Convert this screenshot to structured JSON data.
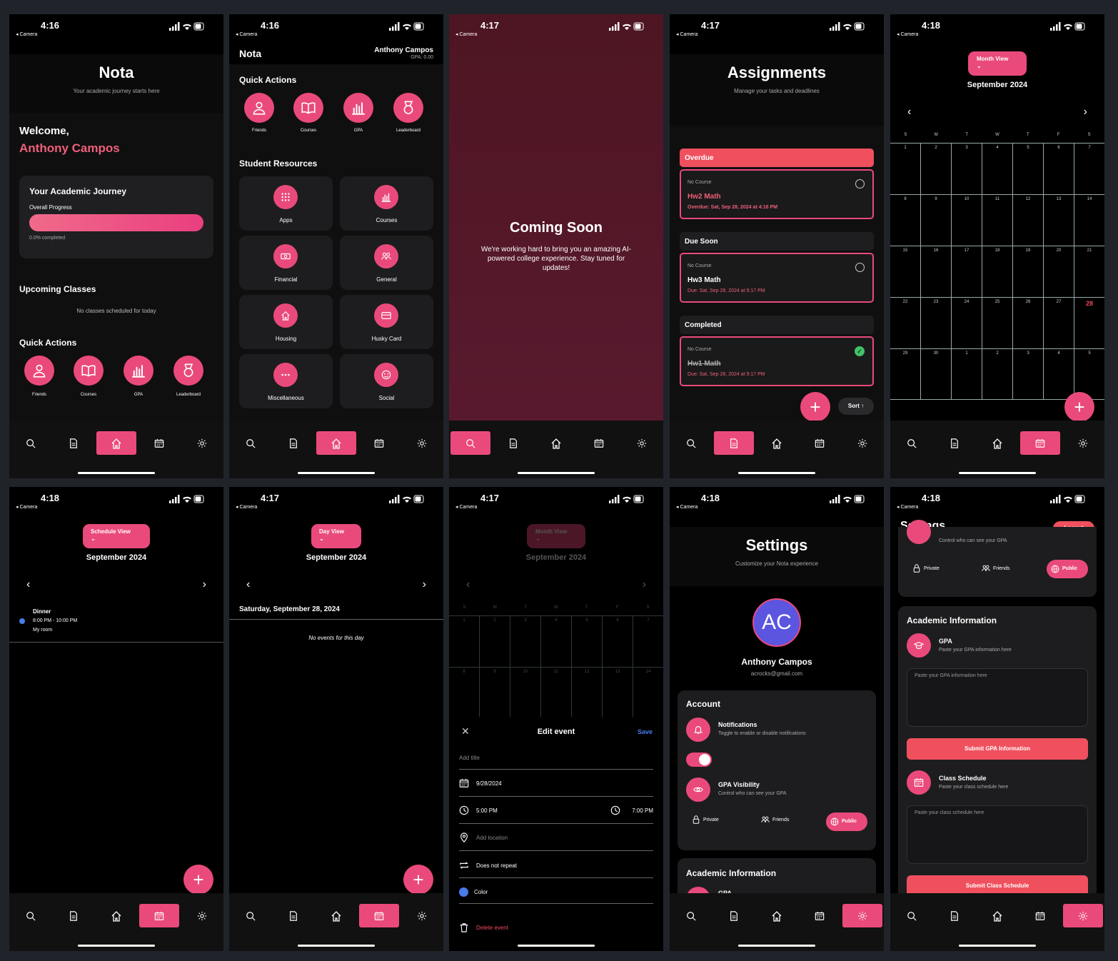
{
  "status": {
    "t1": "4:16",
    "t2": "4:16",
    "t3": "4:17",
    "t4": "4:17",
    "t5": "4:18",
    "t6": "4:18",
    "t7": "4:17",
    "t8": "4:17",
    "t9": "4:18",
    "t10": "4:18",
    "back": "◂ Camera"
  },
  "home": {
    "title": "Nota",
    "subtitle": "Your academic journey starts here",
    "welcome": "Welcome,",
    "name": "Anthony Campos",
    "journey_title": "Your Academic Journey",
    "progress_label": "Overall Progress",
    "progress_text": "0.0% completed",
    "progress_value": 0,
    "upcoming_title": "Upcoming Classes",
    "no_classes": "No classes scheduled for today",
    "qa_title": "Quick Actions",
    "qa": [
      "Friends",
      "Courses",
      "GPA",
      "Leaderboard"
    ]
  },
  "resources": {
    "app": "Nota",
    "user": "Anthony Campos",
    "gpa": "GPA: 0.00",
    "qa_title": "Quick Actions",
    "qa": [
      "Friends",
      "Courses",
      "GPA",
      "Leaderboard"
    ],
    "res_title": "Student Resources",
    "items": [
      "Apps",
      "Courses",
      "Financial",
      "General",
      "Housing",
      "Husky Card",
      "Miscellaneous",
      "Social"
    ]
  },
  "coming": {
    "title": "Coming Soon",
    "body": "We're working hard to bring you an amazing AI-powered college experience. Stay tuned for updates!"
  },
  "assign": {
    "title": "Assignments",
    "subtitle": "Manage your tasks and deadlines",
    "overdue": "Overdue",
    "due_soon": "Due Soon",
    "completed": "Completed",
    "a1": {
      "course": "No Course",
      "name": "Hw2 Math",
      "due": "Overdue: Sat, Sep 28, 2024 at 4:16 PM"
    },
    "a2": {
      "course": "No Course",
      "name": "Hw3 Math",
      "due": "Due: Sat, Sep 28, 2024 at 9:17 PM"
    },
    "a3": {
      "course": "No Course",
      "name": "Hw1 Math",
      "due": "Due: Sat, Sep 28, 2024 at 9:17 PM"
    },
    "sort": "Sort ↑"
  },
  "month": {
    "view": "Month View",
    "month": "September 2024",
    "days": [
      "S",
      "M",
      "T",
      "W",
      "T",
      "F",
      "S"
    ],
    "weeks": [
      [
        "1",
        "2",
        "3",
        "4",
        "5",
        "6",
        "7"
      ],
      [
        "8",
        "9",
        "10",
        "11",
        "12",
        "13",
        "14"
      ],
      [
        "15",
        "16",
        "17",
        "18",
        "19",
        "20",
        "21"
      ],
      [
        "22",
        "23",
        "24",
        "25",
        "26",
        "27",
        "28"
      ],
      [
        "29",
        "30",
        "1",
        "2",
        "3",
        "4",
        "5"
      ]
    ]
  },
  "schedule": {
    "view": "Schedule View",
    "month": "September 2024",
    "event": "Dinner",
    "time": "8:00 PM - 10:00 PM",
    "loc": "My room"
  },
  "day": {
    "view": "Day View",
    "month": "September 2024",
    "date": "Saturday, September 28, 2024",
    "empty": "No events for this day"
  },
  "edit": {
    "view": "Month View",
    "month": "September 2024",
    "title": "Edit event",
    "save": "Save",
    "add_title": "Add title",
    "date": "9/28/2024",
    "start": "5:00 PM",
    "end": "7:00 PM",
    "location": "Add location",
    "repeat": "Does not repeat",
    "color": "Color",
    "delete": "Delete event",
    "days": [
      "S",
      "M",
      "T",
      "W",
      "T",
      "F",
      "S"
    ],
    "w1": [
      "1",
      "2",
      "3",
      "4",
      "5",
      "6",
      "7"
    ],
    "w2": [
      "8",
      "9",
      "10",
      "11",
      "12",
      "13",
      "14"
    ]
  },
  "settings": {
    "title": "Settings",
    "subtitle": "Customize your Nota experience",
    "initials": "AC",
    "name": "Anthony Campos",
    "email": "acrocks@gmail.com",
    "account": "Account",
    "notif": "Notifications",
    "notif_desc": "Toggle to enable or disable notifications",
    "gpa_vis": "GPA Visibility",
    "gpa_vis_desc": "Control who can see your GPA",
    "private": "Private",
    "friends": "Friends",
    "public": "Public",
    "academic": "Academic Information",
    "gpa_short": "GPA"
  },
  "settings2": {
    "title": "Settings",
    "logout": "Logout",
    "vis_desc": "Control who can see your GPA",
    "private": "Private",
    "friends": "Friends",
    "public": "Public",
    "academic": "Academic Information",
    "gpa": "GPA",
    "gpa_desc": "Paste your GPA information here",
    "gpa_ph": "Paste your GPA information here",
    "submit_gpa": "Submit GPA Information",
    "cls": "Class Schedule",
    "cls_desc": "Paste your class schedule here",
    "cls_ph": "Paste your class schedule here",
    "submit_cls": "Submit Class Schedule"
  },
  "colors": {
    "accent": "#ea4a7b",
    "bg": "#000000",
    "card": "#1d1d1f",
    "overdue": "#f0505e"
  }
}
